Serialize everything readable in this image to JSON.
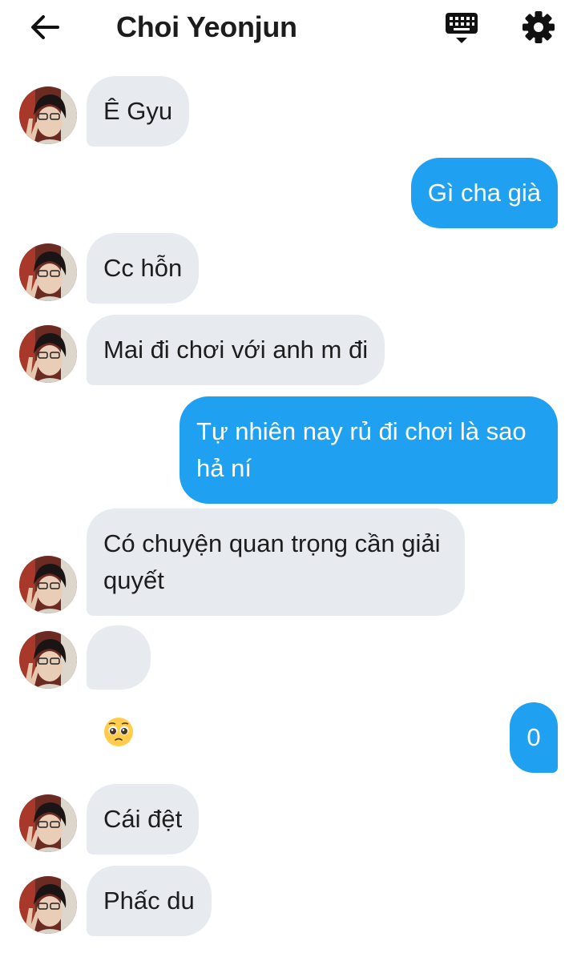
{
  "header": {
    "title": "Choi Yeonjun",
    "back_icon": "arrow-left-icon",
    "keyboard_icon": "keyboard-icon",
    "settings_icon": "gear-icon"
  },
  "colors": {
    "sent_bubble": "#1fa0f1",
    "received_bubble": "#e7ebef"
  },
  "messages": [
    {
      "from": "them",
      "text": "Ê Gyu"
    },
    {
      "from": "me",
      "text": "Gì cha già"
    },
    {
      "from": "them",
      "text": "Cc hỗn"
    },
    {
      "from": "them",
      "text": "Mai đi chơi với anh m đi"
    },
    {
      "from": "me",
      "text": "Tự nhiên nay rủ đi chơi là sao hả ní"
    },
    {
      "from": "them",
      "text": "Có chuyện quan trọng cần giải quyết"
    },
    {
      "from": "them",
      "text": "🥺"
    },
    {
      "from": "me",
      "text": "0"
    },
    {
      "from": "them",
      "text": "Cái đệt"
    },
    {
      "from": "them",
      "text": "Phấc du"
    }
  ]
}
